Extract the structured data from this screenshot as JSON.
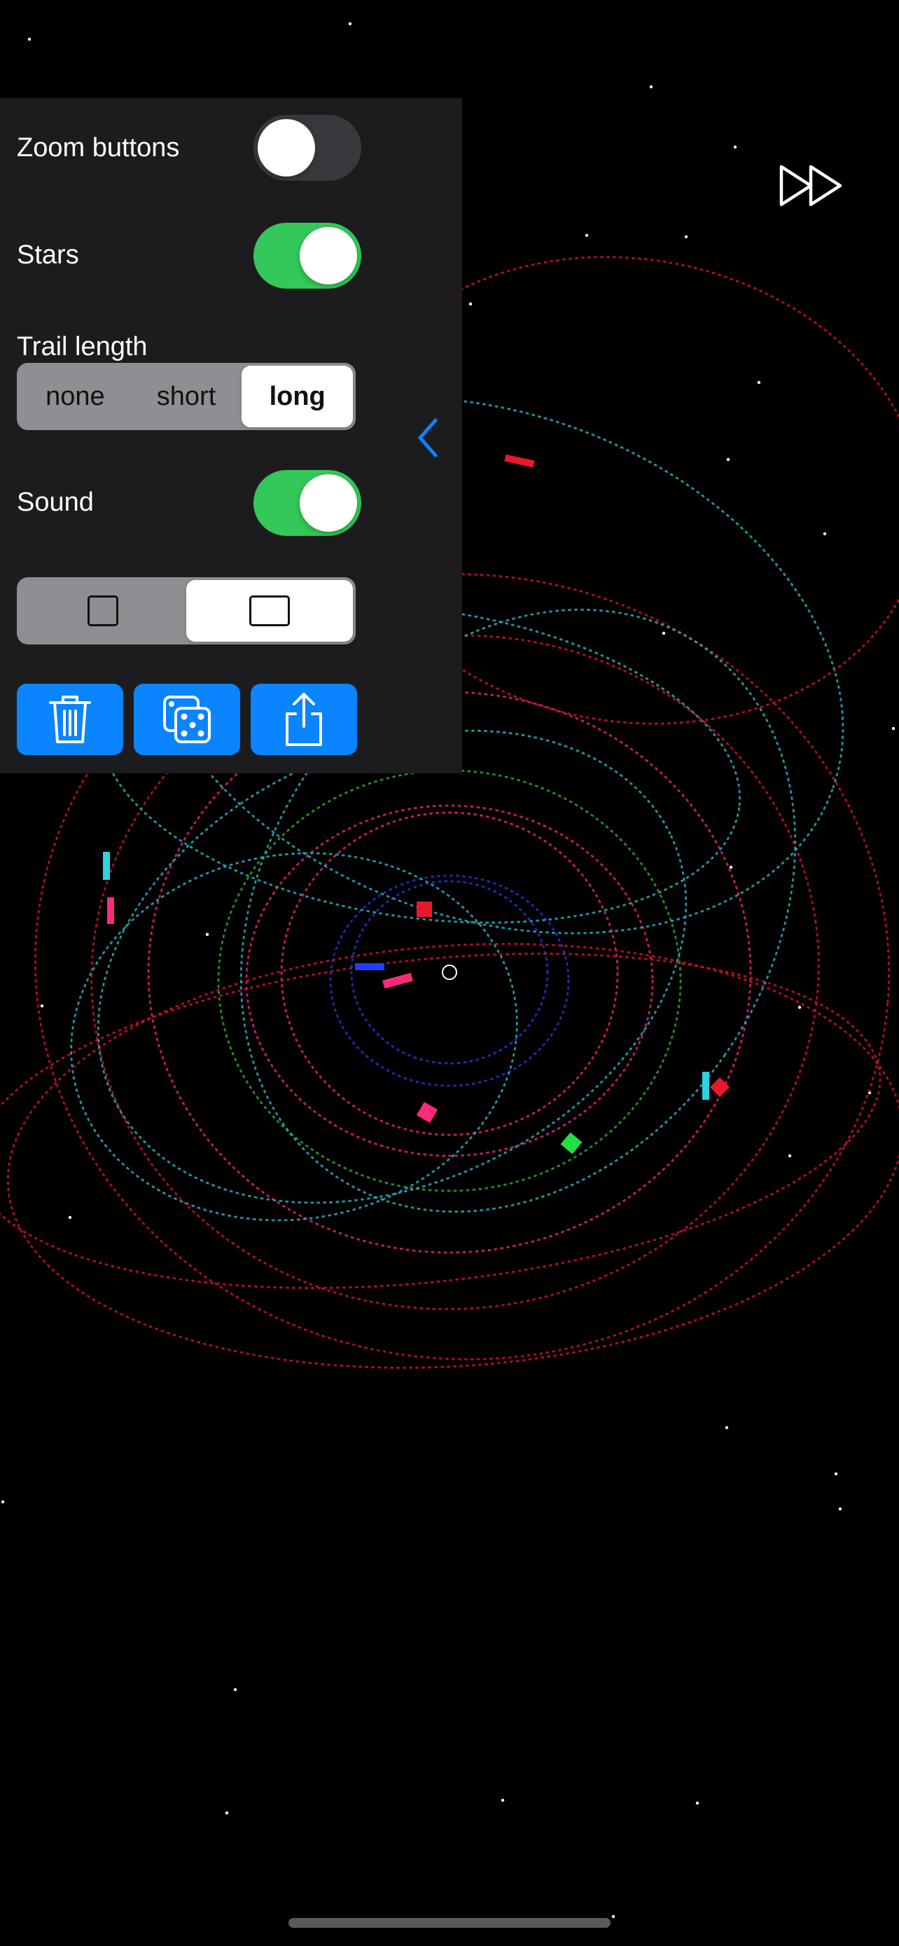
{
  "settings": {
    "zoom_buttons": {
      "label": "Zoom buttons",
      "enabled": false
    },
    "stars": {
      "label": "Stars",
      "enabled": true
    },
    "trail_length": {
      "label": "Trail length",
      "options": [
        "none",
        "short",
        "long"
      ],
      "selected": "long"
    },
    "sound": {
      "label": "Sound",
      "enabled": true
    },
    "shape": {
      "options": [
        "square-icon",
        "wide-rectangle-icon"
      ],
      "selected": "wide-rectangle-icon"
    }
  },
  "actions": [
    {
      "icon": "trash-icon",
      "color": "#0a84ff"
    },
    {
      "icon": "dice-icon",
      "color": "#0a84ff"
    },
    {
      "icon": "share-icon",
      "color": "#0a84ff"
    }
  ],
  "controls": {
    "collapse_icon": "chevron-left-icon",
    "fast_forward_icon": "fast-forward-icon"
  },
  "colors": {
    "toggle_on": "#34c759",
    "toggle_off": "#39393d",
    "accent": "#0a84ff",
    "panel": "#1c1c1e",
    "background": "#000000"
  },
  "simulation": {
    "bodies": [
      {
        "color": "#e8192c",
        "shape": "square"
      },
      {
        "color": "#e8192c",
        "shape": "diamond"
      },
      {
        "color": "#e8192c",
        "shape": "dash"
      },
      {
        "color": "#ff2a7a",
        "shape": "dash"
      },
      {
        "color": "#ff2a7a",
        "shape": "diamond"
      },
      {
        "color": "#ff2a7a",
        "shape": "dash"
      },
      {
        "color": "#1f3dff",
        "shape": "dash"
      },
      {
        "color": "#22dd44",
        "shape": "diamond"
      },
      {
        "color": "#2ad4e0",
        "shape": "dash"
      },
      {
        "color": "#2ad4e0",
        "shape": "dash"
      }
    ],
    "trail_colors": [
      "#c8102e",
      "#e0226e",
      "#2aa8b8",
      "#2ca02c",
      "#2233cc"
    ]
  }
}
